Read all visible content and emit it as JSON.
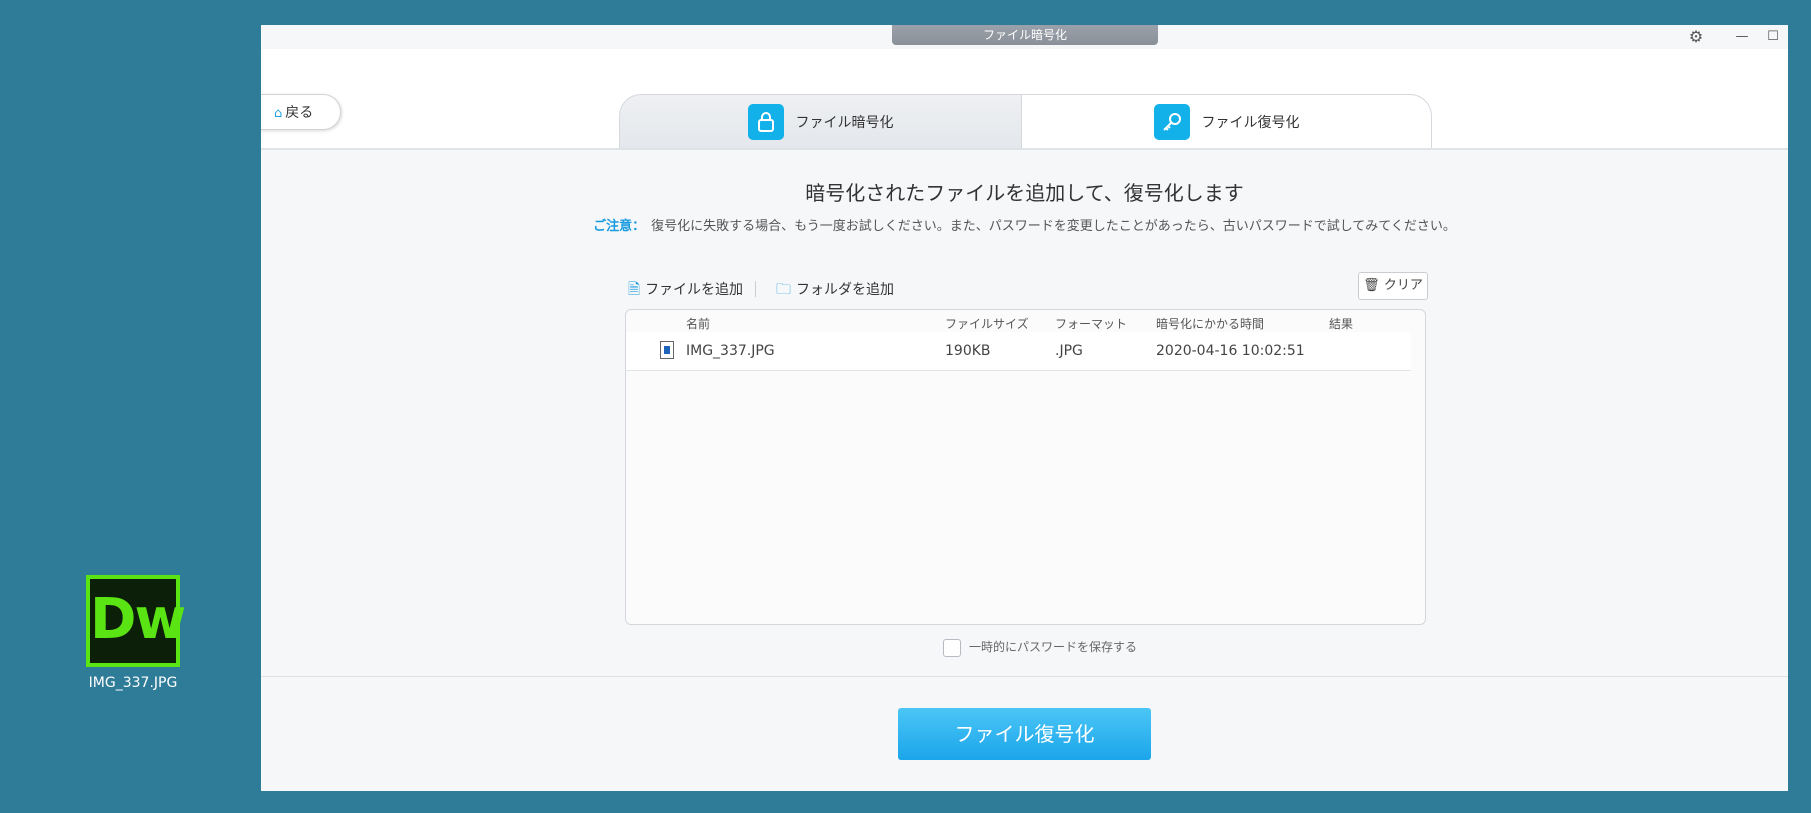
{
  "desktop": {
    "icon_text": "Dw",
    "icon_label": "IMG_337.JPG",
    "colors": {
      "background": "#2e7c98",
      "dw_green": "#5ae414"
    }
  },
  "window": {
    "title": "ファイル暗号化",
    "gear_icon": "gear-icon",
    "minimize_glyph": "—",
    "maximize_glyph": "☐"
  },
  "header": {
    "back_label": "戻る",
    "tabs": [
      {
        "label": "ファイル暗号化",
        "icon": "lock-icon",
        "active": false
      },
      {
        "label": "ファイル復号化",
        "icon": "key-icon",
        "active": true
      }
    ],
    "accent": "#13b1ea"
  },
  "main": {
    "headline": "暗号化されたファイルを追加して、復号化します",
    "notice_label": "ご注意：",
    "notice_text": "復号化に失敗する場合、もう一度お試しください。また、パスワードを変更したことがあったら、古いパスワードで試してみてください。",
    "toolbar": {
      "add_file": "ファイルを追加",
      "add_folder": "フォルダを追加",
      "clear": "クリア"
    },
    "table": {
      "headers": [
        "名前",
        "ファイルサイズ",
        "フォーマット",
        "暗号化にかかる時間",
        "結果"
      ],
      "rows": [
        {
          "name": "IMG_337.JPG",
          "size": "190KB",
          "format": ".JPG",
          "time": "2020-04-16 10:02:51",
          "result": ""
        }
      ]
    },
    "save_password_label": "一時的にパスワードを保存する",
    "save_password_checked": false,
    "primary_button": "ファイル復号化"
  }
}
